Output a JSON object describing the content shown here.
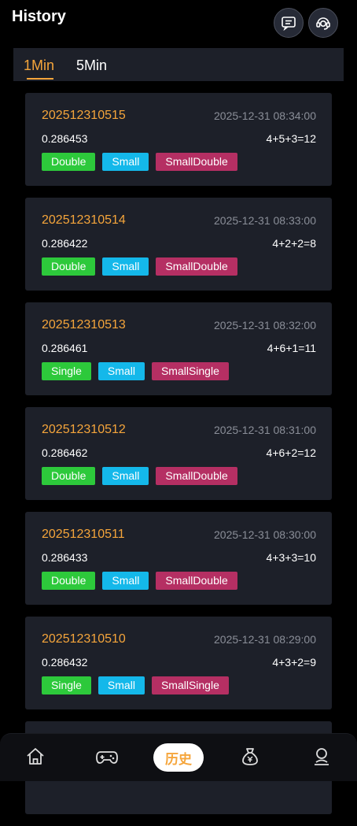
{
  "header": {
    "title": "History"
  },
  "tabs": [
    {
      "label": "1Min"
    },
    {
      "label": "5Min"
    }
  ],
  "records": [
    {
      "period": "202512310515",
      "time": "2025-12-31 08:34:00",
      "value": "0.286453",
      "sum": "4+5+3=12",
      "tags": [
        "Double",
        "Small",
        "SmallDouble"
      ]
    },
    {
      "period": "202512310514",
      "time": "2025-12-31 08:33:00",
      "value": "0.286422",
      "sum": "4+2+2=8",
      "tags": [
        "Double",
        "Small",
        "SmallDouble"
      ]
    },
    {
      "period": "202512310513",
      "time": "2025-12-31 08:32:00",
      "value": "0.286461",
      "sum": "4+6+1=11",
      "tags": [
        "Single",
        "Small",
        "SmallSingle"
      ]
    },
    {
      "period": "202512310512",
      "time": "2025-12-31 08:31:00",
      "value": "0.286462",
      "sum": "4+6+2=12",
      "tags": [
        "Double",
        "Small",
        "SmallDouble"
      ]
    },
    {
      "period": "202512310511",
      "time": "2025-12-31 08:30:00",
      "value": "0.286433",
      "sum": "4+3+3=10",
      "tags": [
        "Double",
        "Small",
        "SmallDouble"
      ]
    },
    {
      "period": "202512310510",
      "time": "2025-12-31 08:29:00",
      "value": "0.286432",
      "sum": "4+3+2=9",
      "tags": [
        "Single",
        "Small",
        "SmallSingle"
      ]
    }
  ],
  "bottom_nav": {
    "active_label": "历史"
  },
  "colors": {
    "accent": "#f5a53b",
    "tag_green": "#2dc93b",
    "tag_blue": "#14b8ea",
    "tag_pink": "#b52f63"
  },
  "icons": [
    "message-icon",
    "customer-service-icon",
    "home-icon",
    "gamepad-icon",
    "money-bag-icon",
    "user-icon"
  ]
}
